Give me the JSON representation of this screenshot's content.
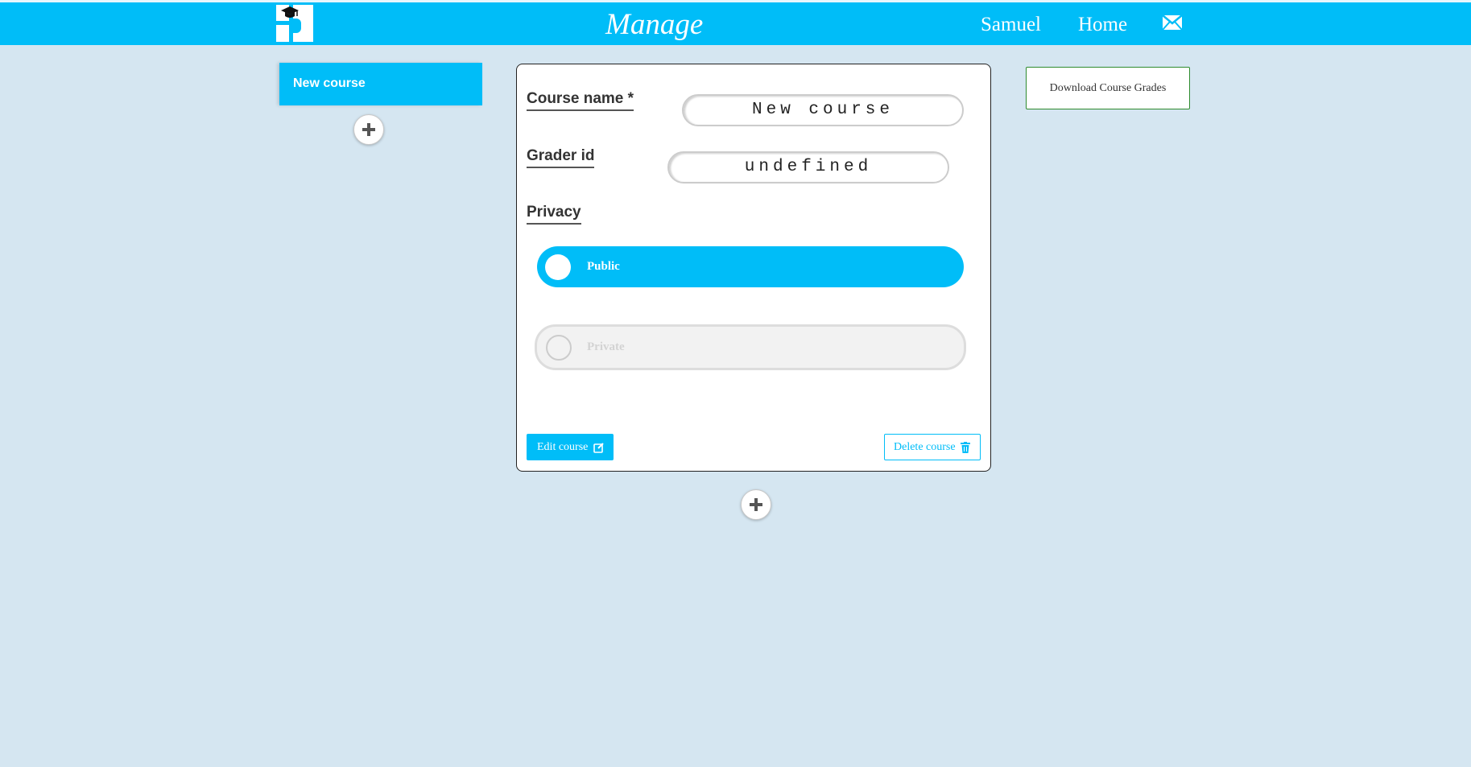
{
  "navbar": {
    "title": "Manage",
    "user_label": "Samuel",
    "home_label": "Home",
    "logo_icon": "graduation-cap-logo",
    "mail_icon": "envelope-icon",
    "color": "#00bdf8"
  },
  "sidebar": {
    "courses": [
      {
        "label": "New course"
      }
    ],
    "add_icon": "plus-icon"
  },
  "course_form": {
    "course_name_label": "Course name *",
    "course_name_value": "New course",
    "grader_id_label": "Grader id",
    "grader_id_value": "undefined",
    "privacy_label": "Privacy",
    "privacy_options": [
      {
        "label": "Public",
        "selected": true
      },
      {
        "label": "Private",
        "selected": false
      }
    ],
    "edit_button": "Edit course",
    "edit_icon": "edit-icon",
    "delete_button": "Delete course",
    "delete_icon": "trash-icon"
  },
  "add_section_icon": "plus-icon",
  "download_button": "Download Course Grades"
}
